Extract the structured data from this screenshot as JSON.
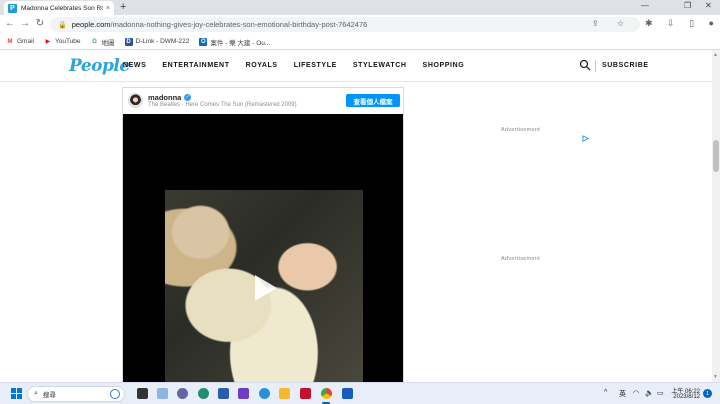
{
  "browser": {
    "tab_title": "Madonna Celebrates Son Ro...",
    "tab_favicon": "P",
    "close_glyph": "×",
    "new_tab_glyph": "+",
    "window_minimize": "—",
    "window_maximize": "❐",
    "window_close": "✕",
    "back_glyph": "←",
    "forward_glyph": "→",
    "reload_glyph": "↻",
    "url_host": "people.com",
    "url_path": "/madonna-nothing-gives-joy-celebrates-son-emotional-birthday-post-7642476",
    "omni_icons": "⇪ ☆",
    "ext_icons": "✱ ⇩ ▯ ●",
    "bookmarks": [
      {
        "label": "Gmail",
        "icon": "gmail-icon",
        "glyph": "M",
        "color": "#ea4335"
      },
      {
        "label": "YouTube",
        "icon": "youtube-icon",
        "glyph": "▶",
        "color": "#ff0000"
      },
      {
        "label": "地圖",
        "icon": "maps-icon",
        "glyph": "G",
        "color": "#34a853"
      },
      {
        "label": "D-Link - DWM-222",
        "icon": "dlink-icon",
        "glyph": "D",
        "color": "#2b5797"
      },
      {
        "label": "案件 - 樂 大建 - Ou...",
        "icon": "outlook-icon",
        "glyph": "O",
        "color": "#0f6cbd"
      }
    ]
  },
  "site": {
    "logo": "People",
    "nav": [
      "NEWS",
      "ENTERTAINMENT",
      "ROYALS",
      "LIFESTYLE",
      "STYLEWATCH",
      "SHOPPING"
    ],
    "subscribe": "SUBSCRIBE"
  },
  "embed": {
    "username": "madonna",
    "verified_glyph": "✓",
    "song": "The Beatles · Here Comes The Sun (Remastered 2009)",
    "view_profile": "查看個人檔案"
  },
  "ads": {
    "label_top": "Advertisement",
    "label_bottom": "Advertisement"
  },
  "taskbar": {
    "search_placeholder": "搜尋",
    "tray_chevron": "^",
    "ime": "英",
    "clock_time": "上午 06:22",
    "clock_date": "2023/8/12",
    "notifications": "1"
  },
  "colors": {
    "people_blue": "#2aa4e0",
    "instagram_blue": "#0095f6",
    "taskbar_bg": "#e7eef8"
  }
}
